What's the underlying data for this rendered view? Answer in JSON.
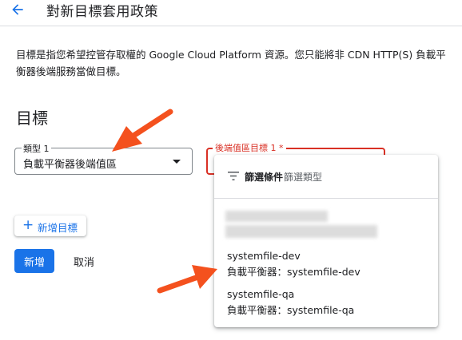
{
  "header": {
    "title": "對新目標套用政策"
  },
  "description": "目標是指您希望控管存取權的 Google Cloud Platform 資源。您只能將非 CDN HTTP(S) 負載平衡器後端服務當做目標。",
  "section": {
    "title": "目標"
  },
  "type_select": {
    "label": "類型 1",
    "value": "負載平衡器後端值區"
  },
  "bucket_field": {
    "label": "後端值區目標 1 *"
  },
  "buttons": {
    "add_target": "新增目標",
    "create": "新增",
    "cancel": "取消"
  },
  "dropdown": {
    "filter_label": "篩選條件",
    "filter_placeholder": "篩選類型",
    "options": [
      {
        "name": "systemfile-dev",
        "sub": "負載平衡器：systemfile-dev"
      },
      {
        "name": "systemfile-qa",
        "sub": "負載平衡器：systemfile-qa"
      }
    ]
  },
  "colors": {
    "primary": "#1a73e8",
    "error": "#d93025",
    "annotation_arrow": "#f4511e"
  },
  "icons": {
    "back": "arrow-back-icon",
    "filter": "filter-list-icon",
    "add": "plus-icon",
    "caret": "dropdown-caret-icon"
  }
}
